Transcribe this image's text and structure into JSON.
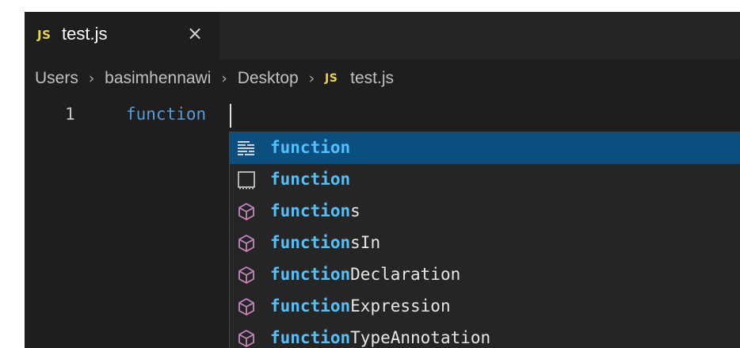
{
  "tab": {
    "badge": "JS",
    "title": "test.js",
    "close": "×"
  },
  "breadcrumb": {
    "items": [
      "Users",
      "basimhennawi",
      "Desktop"
    ],
    "file_badge": "JS",
    "file": "test.js",
    "separator": "›"
  },
  "editor": {
    "line_number": "1",
    "code": "function"
  },
  "suggestions": [
    {
      "icon": "snippet-icon",
      "match": "function",
      "rest": "",
      "selected": true
    },
    {
      "icon": "keyword-icon",
      "match": "function",
      "rest": ""
    },
    {
      "icon": "module-cube-icon",
      "match": "function",
      "rest": "s"
    },
    {
      "icon": "module-cube-icon",
      "match": "function",
      "rest": "sIn"
    },
    {
      "icon": "module-cube-icon",
      "match": "function",
      "rest": "Declaration"
    },
    {
      "icon": "module-cube-icon",
      "match": "function",
      "rest": "Expression"
    },
    {
      "icon": "module-cube-icon",
      "match": "function",
      "rest": "TypeAnnotation"
    }
  ],
  "colors": {
    "editor_bg": "#1e1e1e",
    "selection": "#0a4f7e",
    "keyword": "#569cd6",
    "match_highlight": "#4fc1ff",
    "js_badge": "#e8d44d",
    "cube_icon": "#c586c0"
  }
}
